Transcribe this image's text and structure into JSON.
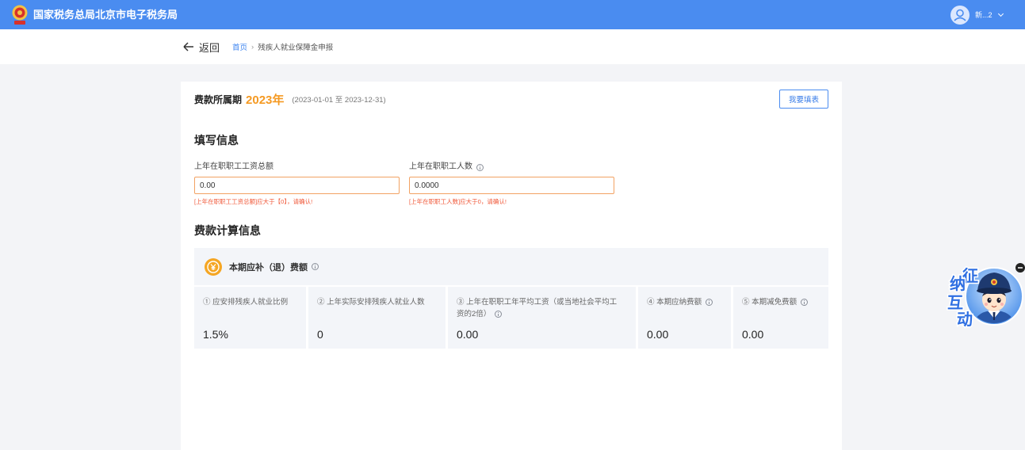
{
  "header": {
    "site_title": "国家税务总局北京市电子税务局",
    "user_name": "新...2",
    "icons": {
      "emblem": "tax-emblem-icon",
      "avatar": "user-avatar-icon",
      "dropdown": "chevron-down-icon"
    },
    "bg_color": "#4a8cf0"
  },
  "subnav": {
    "back_label": "返回",
    "back_icon": "arrow-left-icon",
    "breadcrumb": {
      "home": "首页",
      "separator": "›",
      "current": "残疾人就业保障金申报"
    }
  },
  "period": {
    "label": "费款所属期",
    "year": "2023年",
    "range": "(2023-01-01 至 2023-12-31)",
    "action_button_label": "我要填表"
  },
  "fill_info": {
    "title": "填写信息",
    "fields": [
      {
        "label": "上年在职职工工资总额",
        "value": "0.00",
        "error": "[上年在职职工工资总额]应大于【0】，请确认!"
      },
      {
        "label": "上年在职职工人数",
        "value": "0.0000",
        "error": "[上年在职职工人数]应大于0，请确认!",
        "info_icon": "info-icon"
      }
    ]
  },
  "calc_info": {
    "title": "费款计算信息",
    "summary": {
      "label": "本期应补（退）费额",
      "icon": "yuan-coin-icon",
      "info_icon": "info-icon"
    },
    "items": [
      {
        "label": "① 应安排残疾人就业比例",
        "value": "1.5%"
      },
      {
        "label": "② 上年实际安排残疾人就业人数",
        "value": "0"
      },
      {
        "label": "③ 上年在职职工年平均工资（或当地社会平均工资的2倍）",
        "value": "0.00",
        "info_icon": "info-icon"
      },
      {
        "label": "④ 本期应纳费额",
        "value": "0.00",
        "info_icon": "info-icon"
      },
      {
        "label": "⑤ 本期减免费额",
        "value": "0.00",
        "info_icon": "info-icon"
      }
    ]
  },
  "float_widget": {
    "chars": [
      "征",
      "纳",
      "互",
      "动"
    ],
    "icon": "mascot-icon",
    "collapse_icon": "minus-circle-icon"
  },
  "colors": {
    "primary": "#4a8cf0",
    "accent_orange": "#f59a23",
    "error": "#f0593a",
    "panel_bg": "#f3f5f9"
  }
}
